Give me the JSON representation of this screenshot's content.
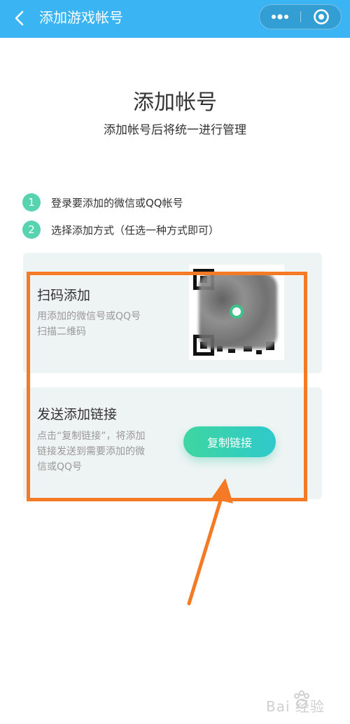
{
  "navbar": {
    "title": "添加游戏帐号",
    "back_icon": "back-chevron-icon",
    "more_icon": "more-dots-icon",
    "close_icon": "mini-program-close-icon",
    "color": "#3ab4f2"
  },
  "header": {
    "title": "添加帐号",
    "subtitle": "添加帐号后将统一进行管理"
  },
  "steps": [
    {
      "num": "1",
      "text": "登录要添加的微信或QQ帐号"
    },
    {
      "num": "2",
      "text": "选择添加方式（任选一种方式即可）"
    }
  ],
  "scan_card": {
    "title": "扫码添加",
    "desc_line1": "用添加的微信号或QQ号",
    "desc_line2": "扫描二维码",
    "qr_icon": "qr-code-icon"
  },
  "link_card": {
    "title": "发送添加链接",
    "desc_line1": "点击“复制链接”，将添加",
    "desc_line2": "链接发送到需要添加的微",
    "desc_line3": "信或QQ号",
    "button_label": "复制链接"
  },
  "annotation": {
    "highlight_color": "#f47a25",
    "arrow_icon": "annotation-arrow-icon"
  },
  "watermark": {
    "text": "Bai 经验",
    "icon": "baidu-paw-icon"
  },
  "colors": {
    "accent_green": "#57d3b0",
    "card_bg": "#eef4f3"
  }
}
